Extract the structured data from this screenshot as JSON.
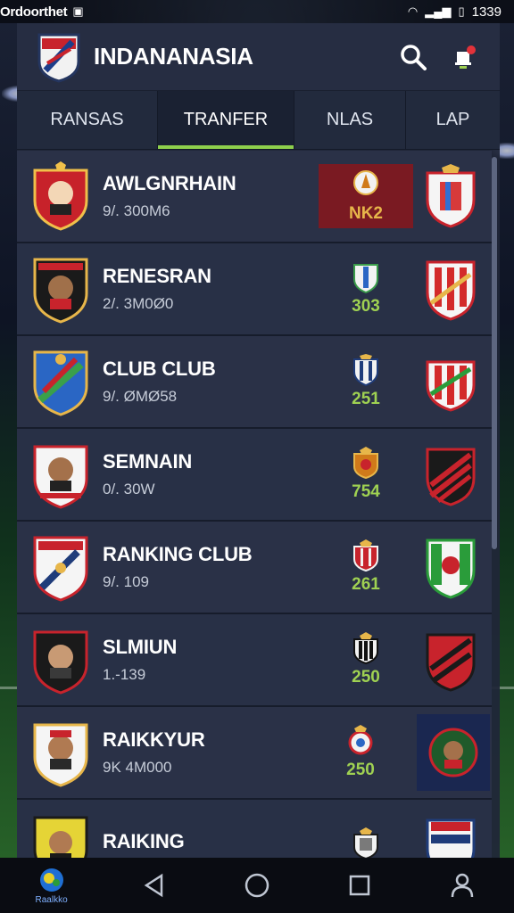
{
  "status_bar": {
    "carrier": "Ordoorthet",
    "time": "1339"
  },
  "header": {
    "title": "INDANANASIA"
  },
  "tabs": [
    {
      "label": "RANSAS",
      "active": false
    },
    {
      "label": "TRANFER",
      "active": true
    },
    {
      "label": "NLAS",
      "active": false
    },
    {
      "label": "LAP",
      "active": false
    }
  ],
  "rows": [
    {
      "name": "AWLGNRHAIN",
      "sub": "9/. 300M6",
      "mid_value": "NK2"
    },
    {
      "name": "RENESRAN",
      "sub": "2/. 3M0Ø0",
      "mid_value": "303"
    },
    {
      "name": "CLUB CLUB",
      "sub": "9/. ØMØ58",
      "mid_value": "251"
    },
    {
      "name": "SEMNAIN",
      "sub": "0/. 30W",
      "mid_value": "754"
    },
    {
      "name": "RANKING CLUB",
      "sub": "9/. 109",
      "mid_value": "261"
    },
    {
      "name": "SLMIUN",
      "sub": "1.-139",
      "mid_value": "250"
    },
    {
      "name": "RAIKKYUR",
      "sub": "9K 4M000",
      "mid_value": "250"
    },
    {
      "name": "RAIKING",
      "sub": "",
      "mid_value": ""
    }
  ],
  "navbar": {
    "home_label": "Raalkko"
  },
  "colors": {
    "accent": "#8ed04c",
    "highlight": "#7a1a22",
    "panel": "#2a3147"
  }
}
